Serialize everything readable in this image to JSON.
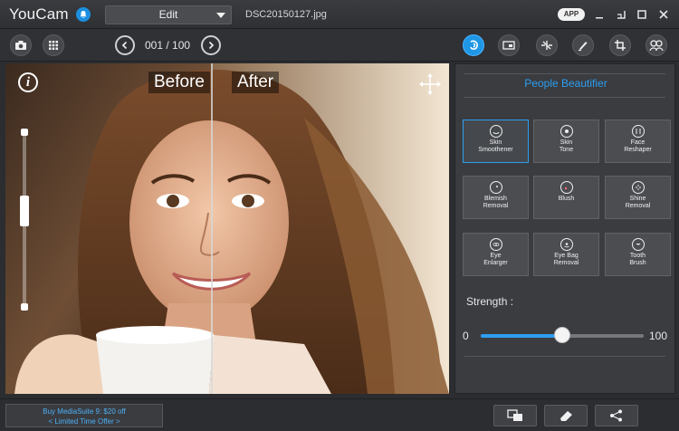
{
  "titlebar": {
    "app_name": "YouCam",
    "mode": "Edit",
    "filename": "DSC20150127.jpg",
    "app_badge": "APP"
  },
  "toolbar": {
    "counter": "001 / 100"
  },
  "photo": {
    "before_label": "Before",
    "after_label": "After",
    "info_glyph": "i"
  },
  "panel": {
    "title": "People Beautifier",
    "features": [
      {
        "line1": "Skin",
        "line2": "Smoothener",
        "icon": "face-smooth-icon",
        "selected": true
      },
      {
        "line1": "Skin",
        "line2": "Tone",
        "icon": "face-tone-icon",
        "selected": false
      },
      {
        "line1": "Face",
        "line2": "Reshaper",
        "icon": "face-reshape-icon",
        "selected": false
      },
      {
        "line1": "Blemish",
        "line2": "Removal",
        "icon": "blemish-icon",
        "selected": false
      },
      {
        "line1": "Blush",
        "line2": "",
        "icon": "blush-icon",
        "selected": false
      },
      {
        "line1": "Shine",
        "line2": "Removal",
        "icon": "shine-icon",
        "selected": false
      },
      {
        "line1": "Eye",
        "line2": "Enlarger",
        "icon": "eye-enlarge-icon",
        "selected": false
      },
      {
        "line1": "Eye Bag",
        "line2": "Removal",
        "icon": "eye-bag-icon",
        "selected": false
      },
      {
        "line1": "Tooth",
        "line2": "Brush",
        "icon": "tooth-icon",
        "selected": false
      }
    ],
    "strength_label": "Strength :",
    "strength_min": "0",
    "strength_max": "100",
    "strength_value": 50
  },
  "bottom": {
    "promo_line1": "Buy  MediaSuite 9: $20 off",
    "promo_line2": "< Limited Time Offer >"
  },
  "colors": {
    "accent": "#2e9ef0",
    "bg": "#2b2d30",
    "panel": "#3a3c40"
  }
}
